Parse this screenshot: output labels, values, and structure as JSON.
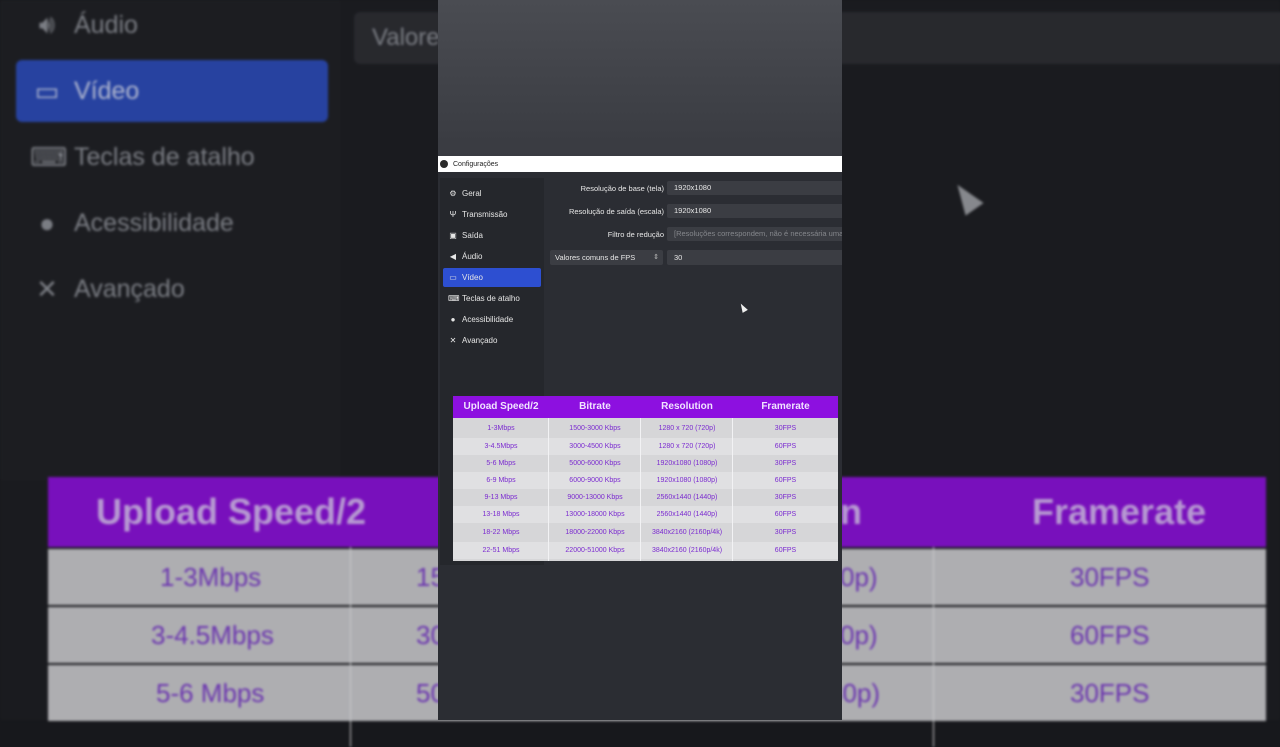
{
  "background": {
    "sidebar": [
      {
        "icon": "speaker-icon",
        "label": "Áudio"
      },
      {
        "icon": "monitor-icon",
        "label": "Vídeo"
      },
      {
        "icon": "keyboard-icon",
        "label": "Teclas de atalho"
      },
      {
        "icon": "accessibility-icon",
        "label": "Acessibilidade"
      },
      {
        "icon": "tools-icon",
        "label": "Avançado"
      }
    ],
    "valores_text": "Valore",
    "table_headers": [
      "Upload Speed/2",
      "n",
      "Framerate"
    ],
    "table_rows": [
      {
        "c1": "1-3Mbps",
        "c2": "15",
        "c3": "0p)",
        "c4": "30FPS"
      },
      {
        "c1": "3-4.5Mbps",
        "c2": "30",
        "c3": "0p)",
        "c4": "60FPS"
      },
      {
        "c1": "5-6 Mbps",
        "c2": "50",
        "c3": "80p)",
        "c4": "30FPS"
      }
    ]
  },
  "window": {
    "title": "Configurações",
    "nav": [
      {
        "icon": "gear-icon",
        "label": "Geral"
      },
      {
        "icon": "antenna-icon",
        "label": "Transmissão"
      },
      {
        "icon": "output-icon",
        "label": "Saída"
      },
      {
        "icon": "speaker-icon",
        "label": "Áudio"
      },
      {
        "icon": "monitor-icon",
        "label": "Vídeo",
        "active": true
      },
      {
        "icon": "keyboard-icon",
        "label": "Teclas de atalho"
      },
      {
        "icon": "accessibility-icon",
        "label": "Acessibilidade"
      },
      {
        "icon": "tools-icon",
        "label": "Avançado"
      }
    ],
    "video": {
      "base_label": "Resolução de base (tela)",
      "base_value": "1920x1080",
      "output_label": "Resolução de saída (escala)",
      "output_value": "1920x1080",
      "filter_label": "Filtro de redução",
      "filter_value": "[Resoluções correspondem, não é necessária uma",
      "fps_select": "Valores comuns de FPS",
      "fps_value": "30"
    }
  },
  "overlay_table": {
    "headers": [
      "Upload Speed/2",
      "Bitrate",
      "Resolution",
      "Framerate"
    ],
    "rows": [
      [
        "1-3Mbps",
        "1500-3000 Kbps",
        "1280 x 720 (720p)",
        "30FPS"
      ],
      [
        "3-4.5Mbps",
        "3000-4500 Kbps",
        "1280 x 720 (720p)",
        "60FPS"
      ],
      [
        "5-6 Mbps",
        "5000-6000 Kbps",
        "1920x1080 (1080p)",
        "30FPS"
      ],
      [
        "6-9 Mbps",
        "6000-9000 Kbps",
        "1920x1080 (1080p)",
        "60FPS"
      ],
      [
        "9-13 Mbps",
        "9000-13000 Kbps",
        "2560x1440 (1440p)",
        "30FPS"
      ],
      [
        "13-18 Mbps",
        "13000-18000 Kbps",
        "2560x1440 (1440p)",
        "60FPS"
      ],
      [
        "18-22 Mbps",
        "18000-22000 Kbps",
        "3840x2160 (2160p/4k)",
        "30FPS"
      ],
      [
        "22-51 Mbps",
        "22000-51000 Kbps",
        "3840x2160 (2160p/4k)",
        "60FPS"
      ]
    ]
  },
  "colors": {
    "accent": "#2d4fd1",
    "table_header": "#8d10e0",
    "table_text": "#7b2bd0"
  }
}
